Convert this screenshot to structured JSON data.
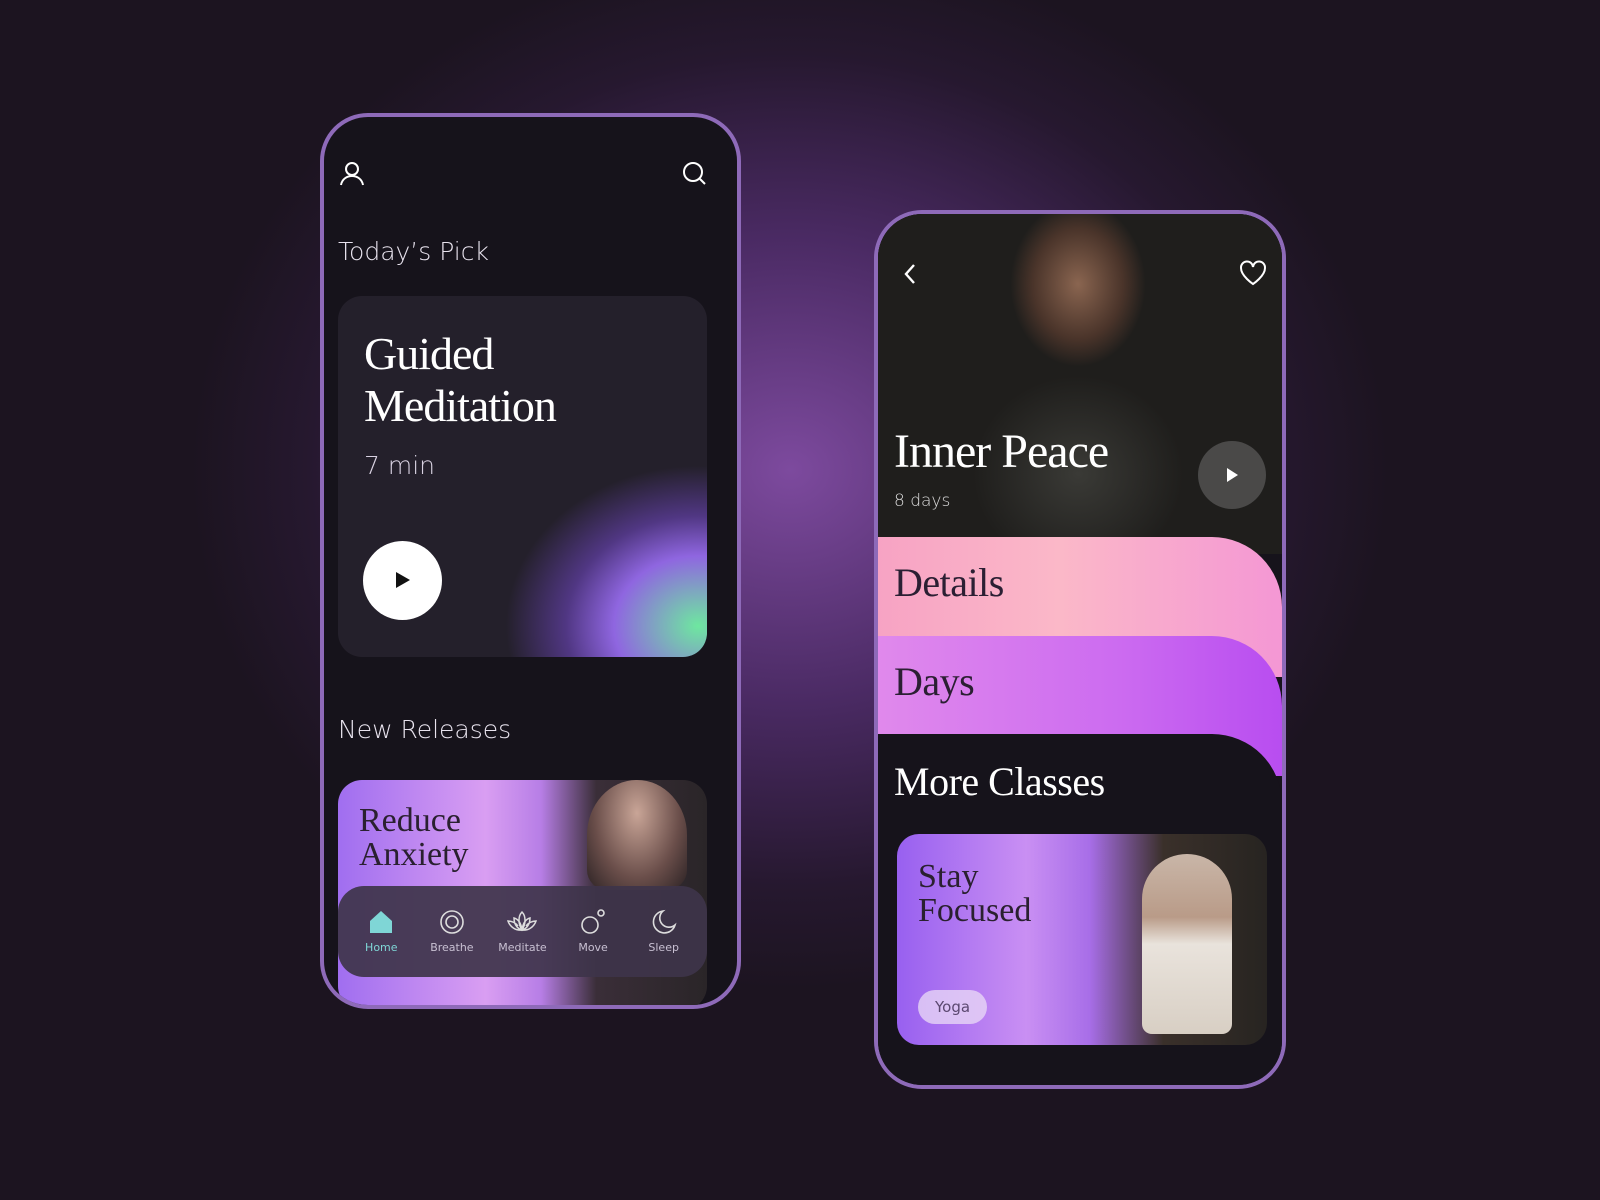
{
  "home": {
    "section_today": "Today’s Pick",
    "featured": {
      "title": "Guided Meditation",
      "duration": "7 min"
    },
    "section_new": "New Releases",
    "release": {
      "title": "Reduce Anxiety"
    },
    "nav": [
      {
        "label": "Home",
        "icon": "home-icon",
        "active": true
      },
      {
        "label": "Breathe",
        "icon": "breathe-icon"
      },
      {
        "label": "Meditate",
        "icon": "lotus-icon"
      },
      {
        "label": "Move",
        "icon": "move-icon"
      },
      {
        "label": "Sleep",
        "icon": "moon-icon"
      }
    ],
    "active_color": "#7fd6d6"
  },
  "detail": {
    "title": "Inner Peace",
    "subtitle": "8 days",
    "tabs": [
      "Details",
      "Days"
    ],
    "section_more": "More Classes",
    "class": {
      "title": "Stay Focused",
      "tag": "Yoga"
    }
  }
}
